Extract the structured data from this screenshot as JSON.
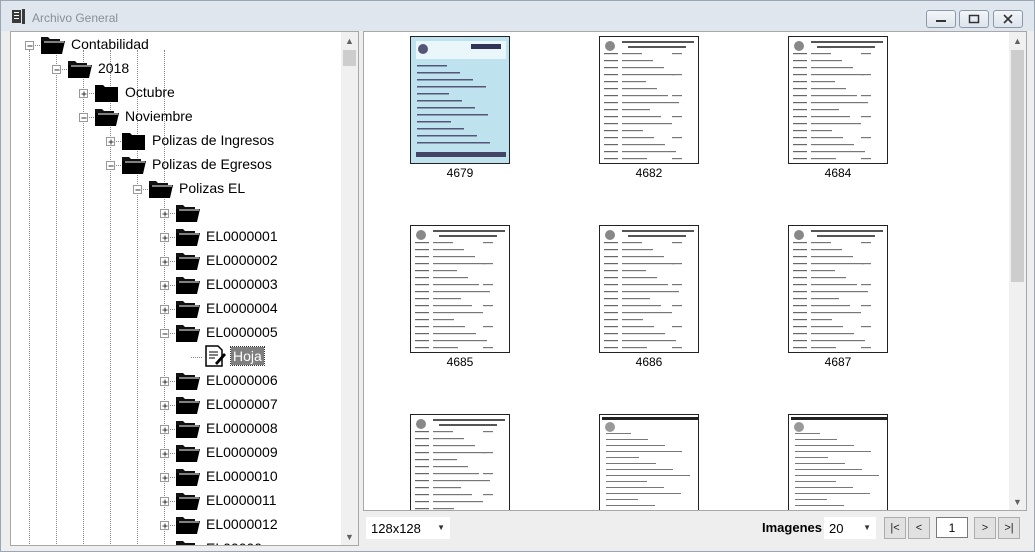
{
  "window": {
    "title": "Archivo General",
    "minimize_icon": "minimize-icon",
    "maximize_icon": "maximize-icon",
    "close_icon": "close-icon"
  },
  "tree": {
    "items": [
      {
        "label": "Contabilidad",
        "level": 0,
        "expanded": true,
        "icon": "folder-open-icon"
      },
      {
        "label": "2018",
        "level": 1,
        "expanded": true,
        "icon": "folder-open-icon"
      },
      {
        "label": "Octubre",
        "level": 2,
        "expanded": false,
        "icon": "folder-closed-icon"
      },
      {
        "label": "Noviembre",
        "level": 2,
        "expanded": true,
        "icon": "folder-open-icon"
      },
      {
        "label": "Polizas de Ingresos",
        "level": 3,
        "expanded": false,
        "icon": "folder-closed-icon"
      },
      {
        "label": "Polizas de Egresos",
        "level": 3,
        "expanded": true,
        "icon": "folder-open-icon"
      },
      {
        "label": "Polizas EL",
        "level": 4,
        "expanded": true,
        "icon": "folder-open-icon"
      },
      {
        "label": "",
        "level": 5,
        "expanded": false,
        "icon": "folder-open-icon"
      },
      {
        "label": "EL0000001",
        "level": 5,
        "expanded": false,
        "icon": "folder-open-icon"
      },
      {
        "label": "EL0000002",
        "level": 5,
        "expanded": false,
        "icon": "folder-open-icon"
      },
      {
        "label": "EL0000003",
        "level": 5,
        "expanded": false,
        "icon": "folder-open-icon"
      },
      {
        "label": "EL0000004",
        "level": 5,
        "expanded": false,
        "icon": "folder-open-icon"
      },
      {
        "label": "EL0000005",
        "level": 5,
        "expanded": true,
        "icon": "folder-open-icon"
      },
      {
        "label": "Hoja",
        "level": 6,
        "expanded": false,
        "icon": "document-icon",
        "selected": true
      },
      {
        "label": "EL0000006",
        "level": 5,
        "expanded": false,
        "icon": "folder-open-icon"
      },
      {
        "label": "EL0000007",
        "level": 5,
        "expanded": false,
        "icon": "folder-open-icon"
      },
      {
        "label": "EL0000008",
        "level": 5,
        "expanded": false,
        "icon": "folder-open-icon"
      },
      {
        "label": "EL0000009",
        "level": 5,
        "expanded": false,
        "icon": "folder-open-icon"
      },
      {
        "label": "EL0000010",
        "level": 5,
        "expanded": false,
        "icon": "folder-open-icon"
      },
      {
        "label": "EL0000011",
        "level": 5,
        "expanded": false,
        "icon": "folder-open-icon"
      },
      {
        "label": "EL0000012",
        "level": 5,
        "expanded": false,
        "icon": "folder-open-icon"
      },
      {
        "label": "EL00000",
        "level": 5,
        "expanded": false,
        "icon": "folder-open-icon"
      }
    ]
  },
  "gallery": {
    "thumbnails": [
      {
        "caption": "4679",
        "style": "blue"
      },
      {
        "caption": "4682",
        "style": "white"
      },
      {
        "caption": "4684",
        "style": "white"
      },
      {
        "caption": "4685",
        "style": "white"
      },
      {
        "caption": "4686",
        "style": "white"
      },
      {
        "caption": "4687",
        "style": "white"
      },
      {
        "caption": "",
        "style": "white"
      },
      {
        "caption": "",
        "style": "stamped"
      },
      {
        "caption": "",
        "style": "stamped"
      }
    ]
  },
  "bottom": {
    "size_select": "128x128",
    "imagenes_label": "Imagenes",
    "per_page_select": "20",
    "first_label": "|<",
    "prev_label": "<",
    "page_value": "1",
    "next_label": ">",
    "last_label": ">|"
  },
  "colors": {
    "titlebar": "#dfe6ee",
    "selection": "#7f7f7f",
    "thumb_blue": "#bfe3ee"
  }
}
